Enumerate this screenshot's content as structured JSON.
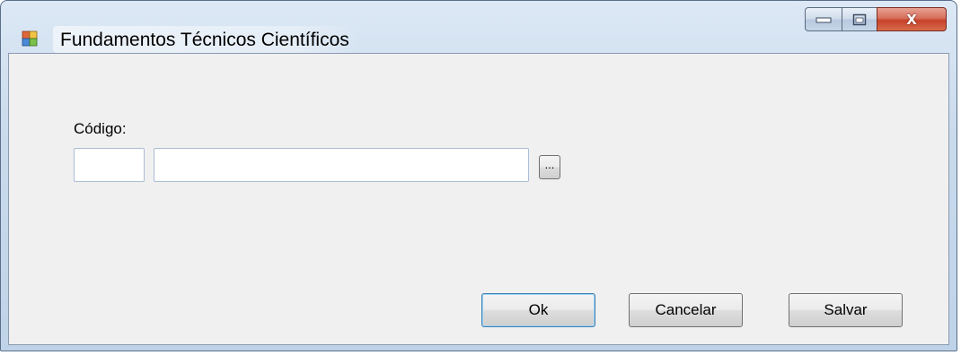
{
  "window": {
    "title": "Fundamentos Técnicos Científicos",
    "icon": "app-form-icon",
    "controls": {
      "minimize_icon": "minimize-icon",
      "maximize_icon": "maximize-icon",
      "close_label": "X"
    }
  },
  "form": {
    "codigo_label": "Código:",
    "codigo_value": "",
    "descricao_value": "",
    "lookup_button_label": "..."
  },
  "buttons": {
    "ok_label": "Ok",
    "cancelar_label": "Cancelar",
    "salvar_label": "Salvar"
  },
  "colors": {
    "client_background": "#f0f0f0",
    "close_button": "#c8412a",
    "default_button_border": "#3c7fb1"
  }
}
